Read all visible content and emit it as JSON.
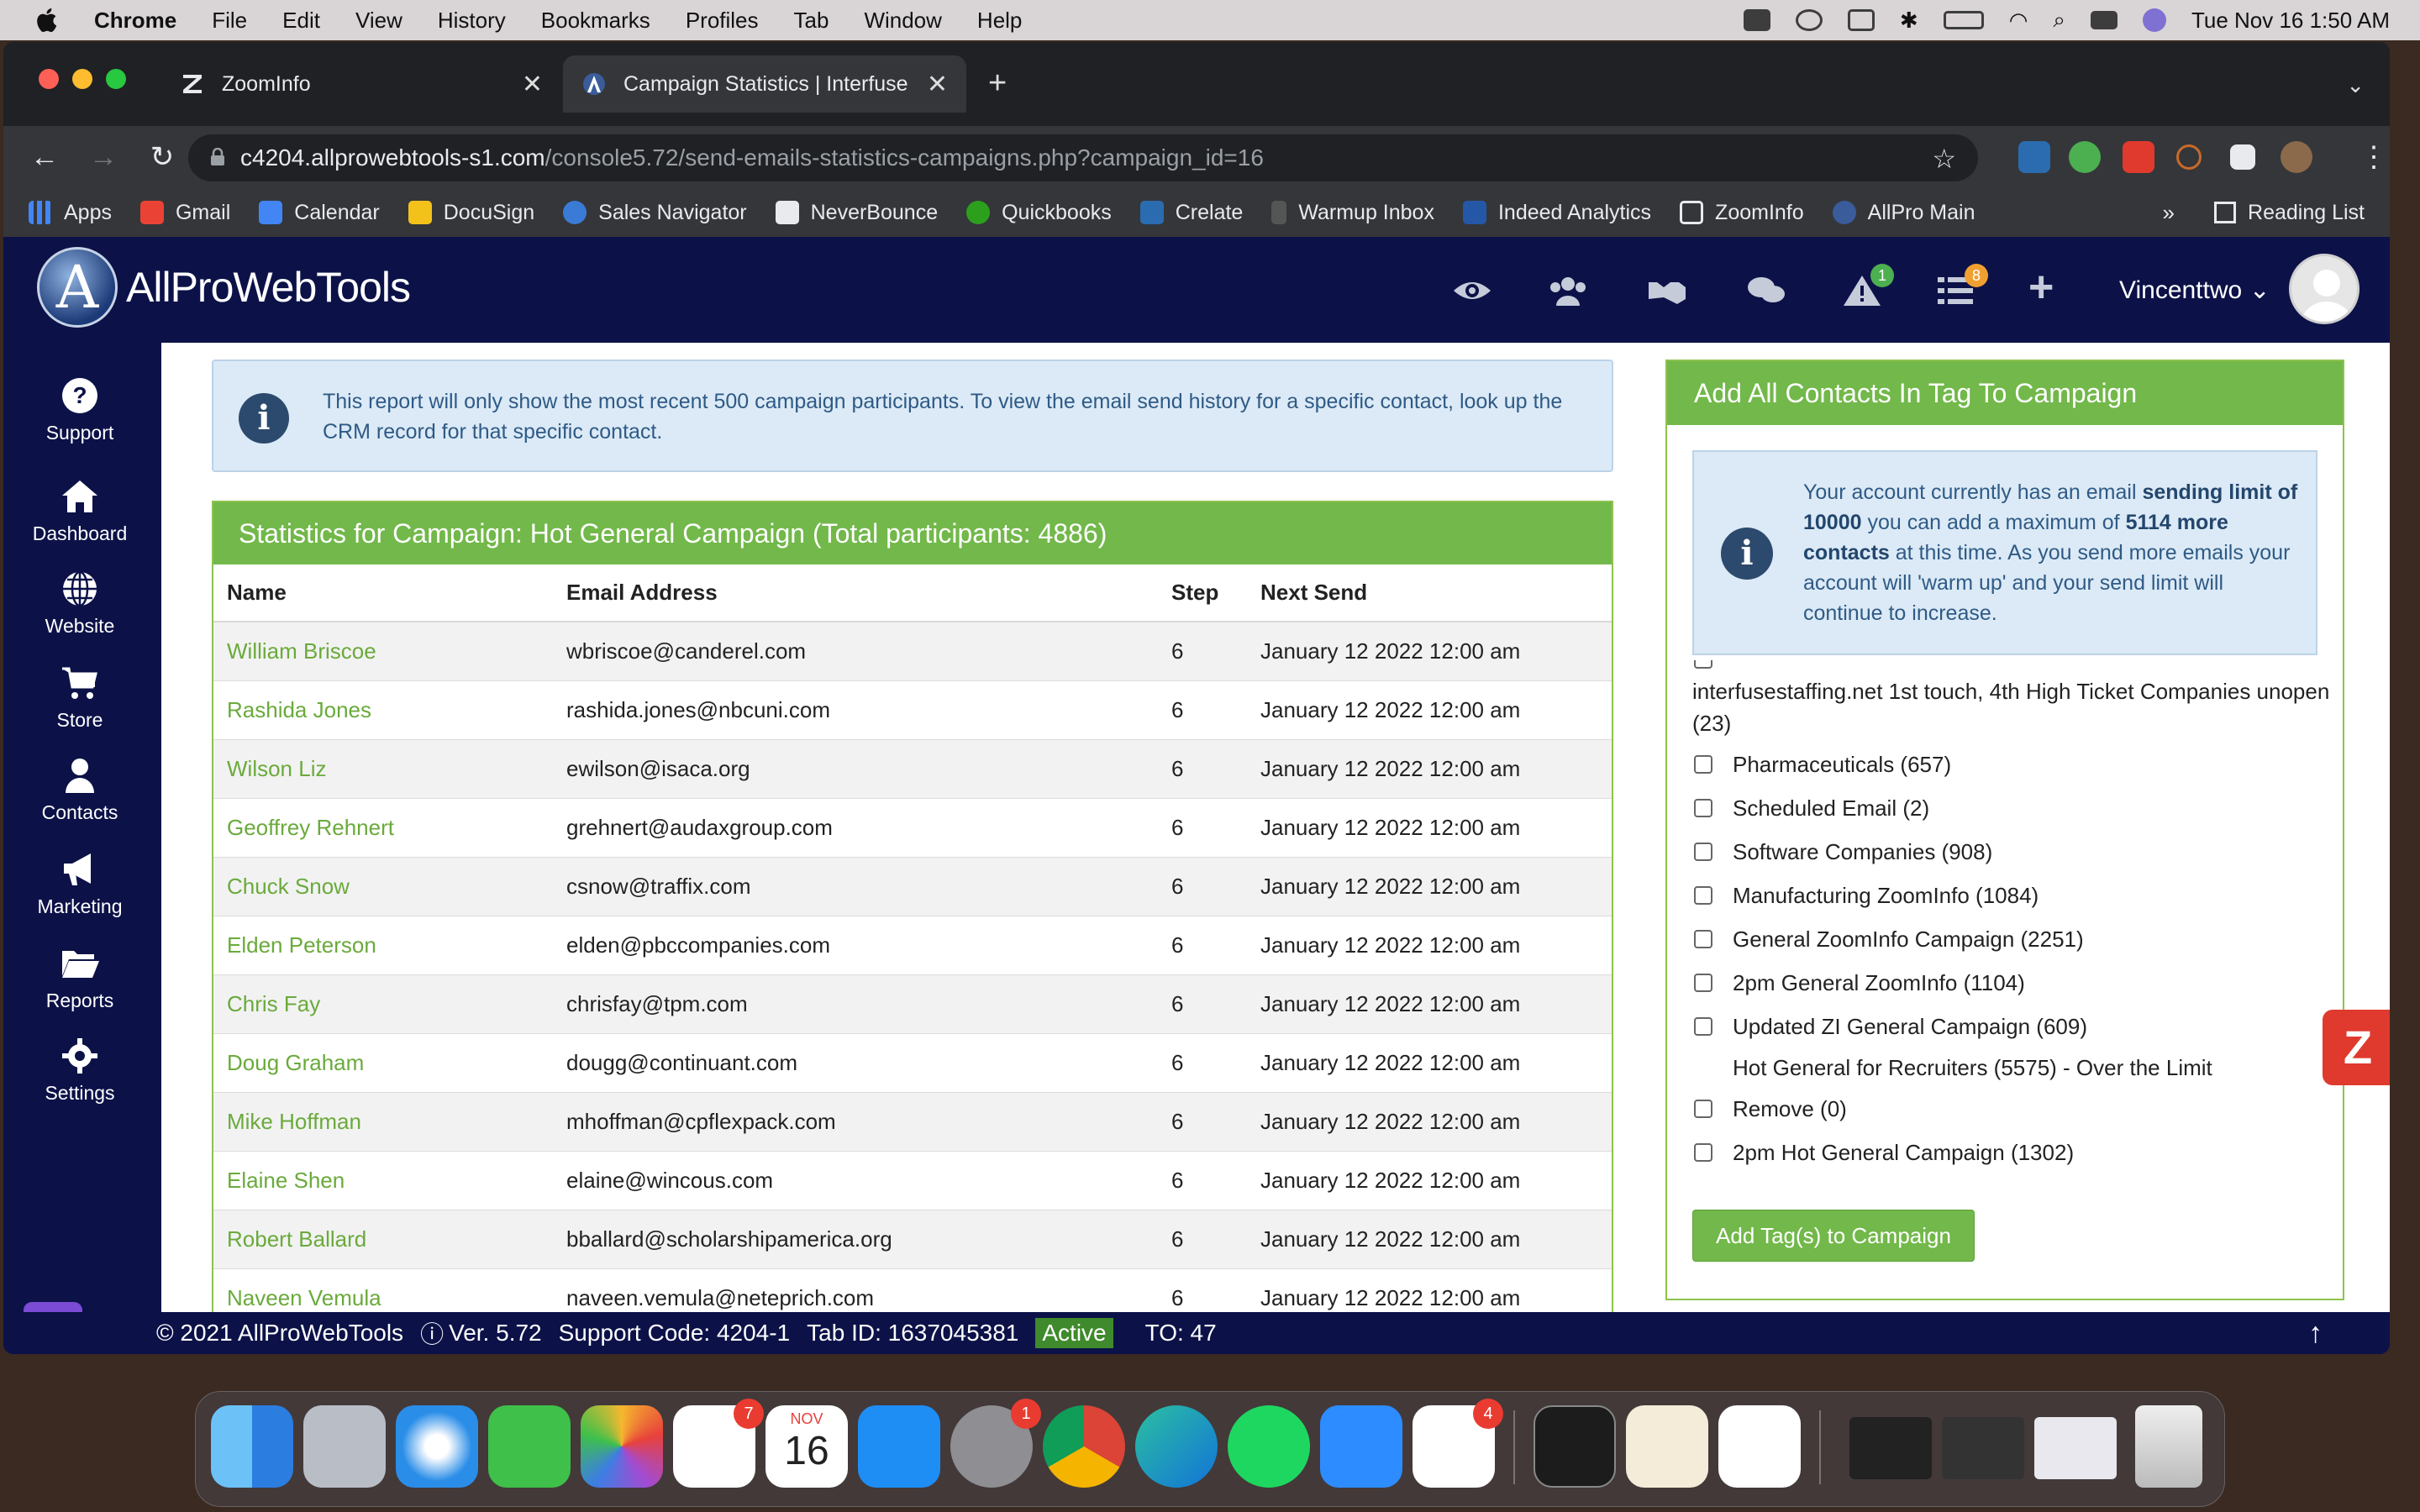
{
  "menubar": {
    "app": "Chrome",
    "items": [
      "File",
      "Edit",
      "View",
      "History",
      "Bookmarks",
      "Profiles",
      "Tab",
      "Window",
      "Help"
    ],
    "clock": "Tue Nov 16  1:50 AM"
  },
  "browser": {
    "tabs": [
      {
        "title": "ZoomInfo",
        "active": false
      },
      {
        "title": "Campaign Statistics | Interfuse",
        "active": true
      }
    ],
    "url_host": "c4204.allprowebtools-s1.com",
    "url_path": "/console5.72/send-emails-statistics-campaigns.php?campaign_id=16",
    "bookmarks": [
      "Apps",
      "Gmail",
      "Calendar",
      "DocuSign",
      "Sales Navigator",
      "NeverBounce",
      "Quickbooks",
      "Crelate",
      "Warmup Inbox",
      "Indeed Analytics",
      "ZoomInfo",
      "AllPro Main"
    ],
    "more": "»",
    "reading_list": "Reading List"
  },
  "app": {
    "brand": "AllProWebTools",
    "user": "Vincenttwo",
    "alerts_badge": "1",
    "tasks_badge": "8",
    "sidebar": [
      "Support",
      "Dashboard",
      "Website",
      "Store",
      "Contacts",
      "Marketing",
      "Reports",
      "Settings"
    ]
  },
  "notice": "This report will only show the most recent 500 campaign participants. To view the email send history for a specific contact, look up the CRM record for that specific contact.",
  "stats": {
    "title": "Statistics for Campaign: Hot General Campaign (Total participants: 4886)",
    "columns": [
      "Name",
      "Email Address",
      "Step",
      "Next Send"
    ],
    "rows": [
      {
        "name": "William Briscoe",
        "email": "wbriscoe@canderel.com",
        "step": "6",
        "next": "January 12 2022 12:00 am"
      },
      {
        "name": "Rashida Jones",
        "email": "rashida.jones@nbcuni.com",
        "step": "6",
        "next": "January 12 2022 12:00 am"
      },
      {
        "name": "Wilson Liz",
        "email": "ewilson@isaca.org",
        "step": "6",
        "next": "January 12 2022 12:00 am"
      },
      {
        "name": "Geoffrey Rehnert",
        "email": "grehnert@audaxgroup.com",
        "step": "6",
        "next": "January 12 2022 12:00 am"
      },
      {
        "name": "Chuck Snow",
        "email": "csnow@traffix.com",
        "step": "6",
        "next": "January 12 2022 12:00 am"
      },
      {
        "name": "Elden Peterson",
        "email": "elden@pbccompanies.com",
        "step": "6",
        "next": "January 12 2022 12:00 am"
      },
      {
        "name": "Chris Fay",
        "email": "chrisfay@tpm.com",
        "step": "6",
        "next": "January 12 2022 12:00 am"
      },
      {
        "name": "Doug Graham",
        "email": "dougg@continuant.com",
        "step": "6",
        "next": "January 12 2022 12:00 am"
      },
      {
        "name": "Mike Hoffman",
        "email": "mhoffman@cpflexpack.com",
        "step": "6",
        "next": "January 12 2022 12:00 am"
      },
      {
        "name": "Elaine Shen",
        "email": "elaine@wincous.com",
        "step": "6",
        "next": "January 12 2022 12:00 am"
      },
      {
        "name": "Robert Ballard",
        "email": "bballard@scholarshipamerica.org",
        "step": "6",
        "next": "January 12 2022 12:00 am"
      },
      {
        "name": "Naveen Vemula",
        "email": "naveen.vemula@neteprich.com",
        "step": "6",
        "next": "January 12 2022 12:00 am"
      }
    ]
  },
  "tag_panel": {
    "title": "Add All Contacts In Tag To Campaign",
    "note_parts": [
      "Your account currently has an email ",
      "sending limit of 10000",
      " you can add a maximum of ",
      "5114 more contacts",
      " at this time. As you send more emails your account will 'warm up' and your send limit will continue to increase."
    ],
    "partial_tag": "interfusestaffing.net 1st touch, 4th High Ticket Companies unopen (23)",
    "tags": [
      "Pharmaceuticals (657)",
      "Scheduled Email (2)",
      "Software Companies (908)",
      "Manufacturing ZoomInfo (1084)",
      "General ZoomInfo Campaign (2251)",
      "2pm General ZoomInfo (1104)",
      "Updated ZI General Campaign (609)"
    ],
    "no_checkbox_tag": "Hot General for Recruiters (5575) - Over the Limit",
    "tags_after": [
      "Remove (0)",
      "2pm Hot General Campaign (1302)"
    ],
    "button": "Add Tag(s) to Campaign"
  },
  "footer": {
    "copyright": "© 2021 AllProWebTools",
    "version": "Ver. 5.72",
    "support": "Support Code: 4204-1",
    "tabid": "Tab ID: 1637045381",
    "status": "Active",
    "to": "TO: 47"
  },
  "dock": {
    "reminders_badge": "7",
    "settings_badge": "1",
    "slack_badge": "4",
    "calendar_month": "NOV",
    "calendar_day": "16"
  }
}
